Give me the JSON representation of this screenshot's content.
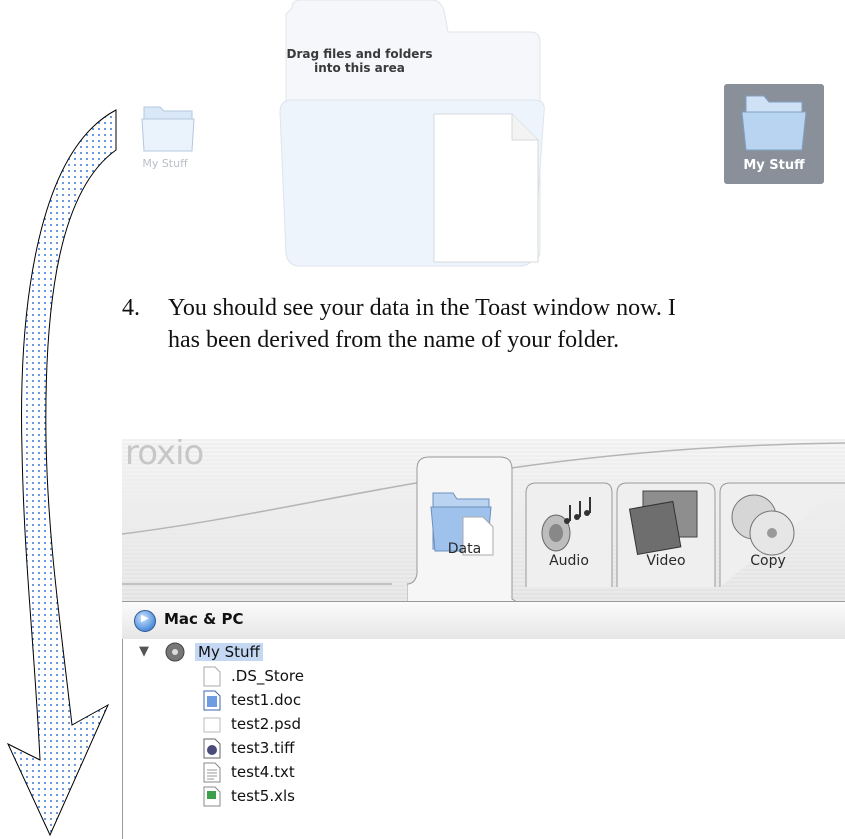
{
  "desktop": {
    "small_folder_label": "My Stuff",
    "selected_folder_label": "My Stuff"
  },
  "drop_zone": {
    "line1": "Drag files and folders",
    "line2": "into this area"
  },
  "instruction": {
    "number": "4.",
    "line1": "You should see your data in the Toast window now. I",
    "line2": "has been derived from the name of your folder."
  },
  "toast": {
    "brand": "roxio",
    "tabs": [
      {
        "label": "Data",
        "icon": "data-folder-icon"
      },
      {
        "label": "Audio",
        "icon": "audio-speaker-icon"
      },
      {
        "label": "Video",
        "icon": "video-film-icon"
      },
      {
        "label": "Copy",
        "icon": "copy-discs-icon"
      }
    ],
    "format_label": "Mac & PC",
    "disc_name": "My Stuff",
    "files": [
      {
        "name": ".DS_Store",
        "icon": "blank-file-icon"
      },
      {
        "name": "test1.doc",
        "icon": "doc-file-icon"
      },
      {
        "name": "test2.psd",
        "icon": "psd-file-icon"
      },
      {
        "name": "test3.tiff",
        "icon": "image-file-icon"
      },
      {
        "name": "test4.txt",
        "icon": "text-file-icon"
      },
      {
        "name": "test5.xls",
        "icon": "spreadsheet-file-icon"
      }
    ]
  },
  "colors": {
    "selected_folder_bg": "#8a9099",
    "selection_highlight": "#c5d8f3",
    "arrow_dots": "#3a7bd5"
  }
}
